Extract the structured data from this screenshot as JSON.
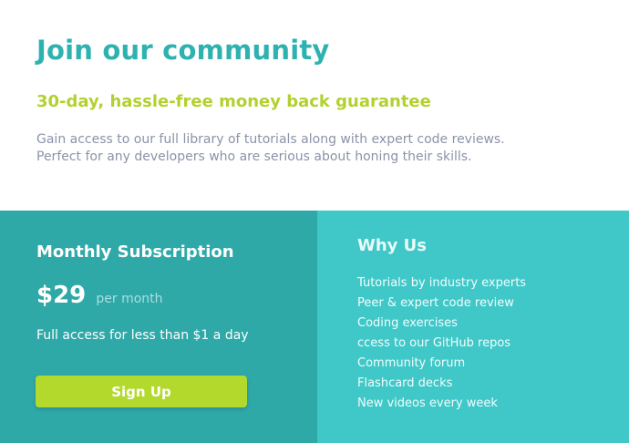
{
  "header": {
    "title": "Join our community",
    "guarantee": "30-day, hassle-free money back guarantee",
    "description_lines": [
      "Gain access to our full library of tutorials along with expert code reviews.",
      "Perfect for any developers who are serious about honing their skills."
    ]
  },
  "subscription": {
    "title": "Monthly Subscription",
    "price": "$29",
    "period": "per month",
    "access_text": "Full access for less than $1 a day",
    "button_label": "Sign Up"
  },
  "why_us": {
    "title": "Why Us",
    "items": [
      "Tutorials by industry experts",
      "Peer & expert code review",
      "Coding exercises",
      "ccess to our GitHub repos",
      "Community forum",
      "Flashcard decks",
      "New videos every week"
    ]
  },
  "colors": {
    "title": "#2eb2b0",
    "guarantee": "#b2d12e",
    "description": "#8c93a9",
    "left_panel": "#2fa8a8",
    "right_panel": "#40c8c8",
    "button": "#b3d92c"
  }
}
